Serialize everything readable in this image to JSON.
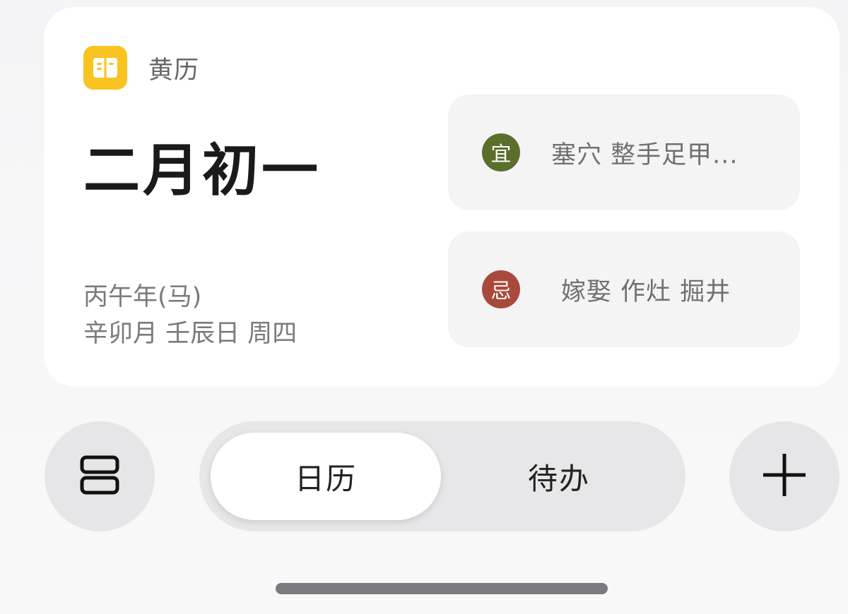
{
  "widget": {
    "app_name": "黄历",
    "app_icon": "almanac-book-icon",
    "accent_color": "#f9c321",
    "lunar_date": "二月初一",
    "year_line": "丙午年(马)",
    "detail_line": "辛卯月 壬辰日 周四",
    "yi": {
      "badge": "宜",
      "color": "#5b6f2d",
      "text": "塞穴  整手足甲..."
    },
    "ji": {
      "badge": "忌",
      "color": "#a9493c",
      "text": "嫁娶  作灶  掘井"
    }
  },
  "bottom_bar": {
    "layout_button_icon": "layout-toggle-icon",
    "tabs": [
      {
        "label": "日历",
        "selected": true
      },
      {
        "label": "待办",
        "selected": false
      }
    ],
    "add_button_icon": "plus-icon"
  }
}
